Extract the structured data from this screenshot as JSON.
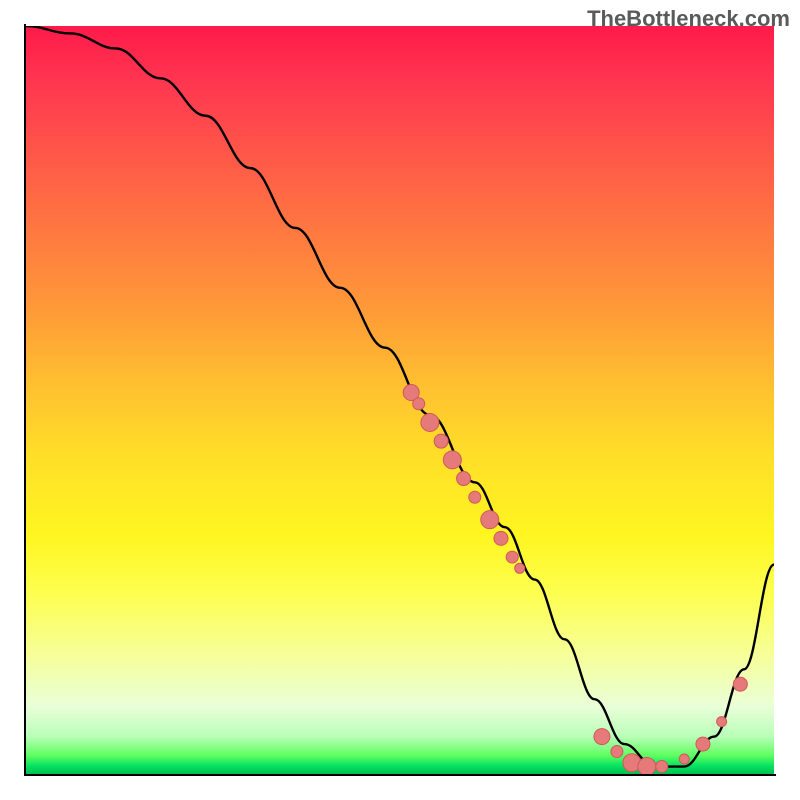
{
  "watermark": "TheBottleneck.com",
  "chart_data": {
    "type": "line",
    "title": "",
    "xlabel": "",
    "ylabel": "",
    "xlim": [
      0,
      100
    ],
    "ylim": [
      0,
      100
    ],
    "grid": false,
    "series": [
      {
        "name": "bottleneck-curve",
        "x": [
          0,
          6,
          12,
          18,
          24,
          30,
          36,
          42,
          48,
          54,
          60,
          64,
          68,
          72,
          76,
          80,
          84,
          88,
          92,
          96,
          100
        ],
        "y": [
          100,
          99,
          97,
          93,
          88,
          81,
          73,
          65,
          57,
          48,
          39,
          33,
          26,
          18,
          10,
          4,
          1,
          1,
          5,
          14,
          28
        ]
      }
    ],
    "markers": [
      {
        "x": 51.5,
        "y": 51,
        "r": 8
      },
      {
        "x": 52.5,
        "y": 49.5,
        "r": 6
      },
      {
        "x": 54,
        "y": 47,
        "r": 9
      },
      {
        "x": 55.5,
        "y": 44.5,
        "r": 7
      },
      {
        "x": 57,
        "y": 42,
        "r": 9
      },
      {
        "x": 58.5,
        "y": 39.5,
        "r": 7
      },
      {
        "x": 60,
        "y": 37,
        "r": 6
      },
      {
        "x": 62,
        "y": 34,
        "r": 9
      },
      {
        "x": 63.5,
        "y": 31.5,
        "r": 7
      },
      {
        "x": 65,
        "y": 29,
        "r": 6
      },
      {
        "x": 66,
        "y": 27.5,
        "r": 5
      },
      {
        "x": 77,
        "y": 5,
        "r": 8
      },
      {
        "x": 79,
        "y": 3,
        "r": 6
      },
      {
        "x": 81,
        "y": 1.5,
        "r": 9
      },
      {
        "x": 83,
        "y": 1,
        "r": 9
      },
      {
        "x": 85,
        "y": 1,
        "r": 6
      },
      {
        "x": 88,
        "y": 2,
        "r": 5
      },
      {
        "x": 90.5,
        "y": 4,
        "r": 7
      },
      {
        "x": 93,
        "y": 7,
        "r": 5
      },
      {
        "x": 95.5,
        "y": 12,
        "r": 7
      }
    ],
    "gradient_stops": [
      {
        "pos": 0,
        "color": "#ff1a4a"
      },
      {
        "pos": 50,
        "color": "#ffe028"
      },
      {
        "pos": 97,
        "color": "#60ff60"
      },
      {
        "pos": 100,
        "color": "#00c050"
      }
    ],
    "marker_color": "#e67a7a",
    "marker_stroke": "#d05858"
  }
}
